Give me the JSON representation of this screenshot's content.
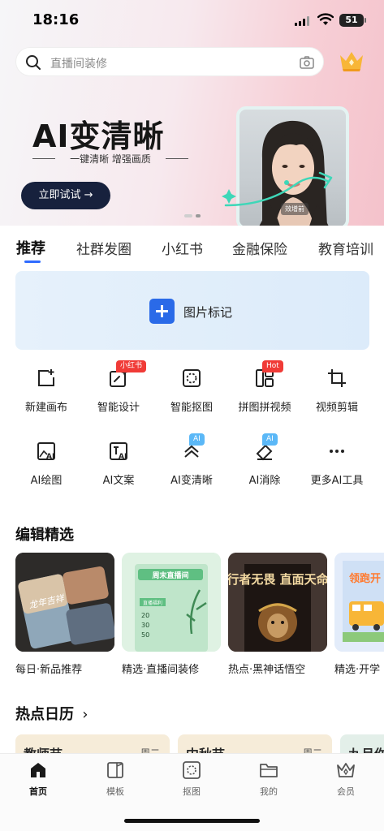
{
  "status_bar": {
    "time": "18:16",
    "battery": "51"
  },
  "search": {
    "placeholder": "直播间装修"
  },
  "banner": {
    "title": "AI变清晰",
    "subtitle": "一键清晰  增强画质",
    "button_label": "立即试试 →",
    "photo_tag": "效增前"
  },
  "tabs": [
    {
      "label": "推荐",
      "active": true
    },
    {
      "label": "社群发圈"
    },
    {
      "label": "小红书"
    },
    {
      "label": "金融保险"
    },
    {
      "label": "教育培训"
    }
  ],
  "mark_card": {
    "label": "图片标记"
  },
  "tools_row1": [
    {
      "label": "新建画布",
      "icon": "new-canvas-icon"
    },
    {
      "label": "智能设计",
      "icon": "smart-design-icon",
      "badge": "小红书"
    },
    {
      "label": "智能抠图",
      "icon": "smart-cutout-icon"
    },
    {
      "label": "拼图拼视频",
      "icon": "collage-video-icon",
      "badge": "Hot"
    },
    {
      "label": "视频剪辑",
      "icon": "video-crop-icon"
    }
  ],
  "tools_row2": [
    {
      "label": "AI绘图",
      "icon": "ai-paint-icon"
    },
    {
      "label": "AI文案",
      "icon": "ai-copywriting-icon"
    },
    {
      "label": "AI变清晰",
      "icon": "ai-sharpen-icon",
      "badge": "AI"
    },
    {
      "label": "AI消除",
      "icon": "ai-eraser-icon",
      "badge": "AI"
    },
    {
      "label": "更多AI工具",
      "icon": "more-icon"
    }
  ],
  "editor_picks": {
    "title": "编辑精选",
    "cards": [
      {
        "label": "每日·新品推荐",
        "art_text": "龙年吉祥"
      },
      {
        "label": "精选·直播间装修",
        "art_text": "周末直播间",
        "sub_text": "直播福利",
        "prices": [
          "20",
          "30",
          "50"
        ]
      },
      {
        "label": "热点·黑神话悟空",
        "art_text": "行者无畏 直面天命"
      },
      {
        "label": "精选·开学",
        "art_text": "领跑开"
      }
    ]
  },
  "hot_calendar": {
    "title": "热点日历",
    "chevron": "›",
    "items": [
      {
        "name": "教师节",
        "day": "周二"
      },
      {
        "name": "中秋节",
        "day": "周二"
      },
      {
        "name": "九月你"
      }
    ]
  },
  "bottom_nav": [
    {
      "label": "首页",
      "icon": "home-icon",
      "active": true
    },
    {
      "label": "模板",
      "icon": "template-icon"
    },
    {
      "label": "抠图",
      "icon": "cutout-icon"
    },
    {
      "label": "我的",
      "icon": "folder-icon"
    },
    {
      "label": "会员",
      "icon": "vip-crown-icon"
    }
  ],
  "colors": {
    "accent": "#2f6bff",
    "badge_red": "#f03b37",
    "badge_blue": "#5bb8f7",
    "banner_button": "#17213d"
  }
}
